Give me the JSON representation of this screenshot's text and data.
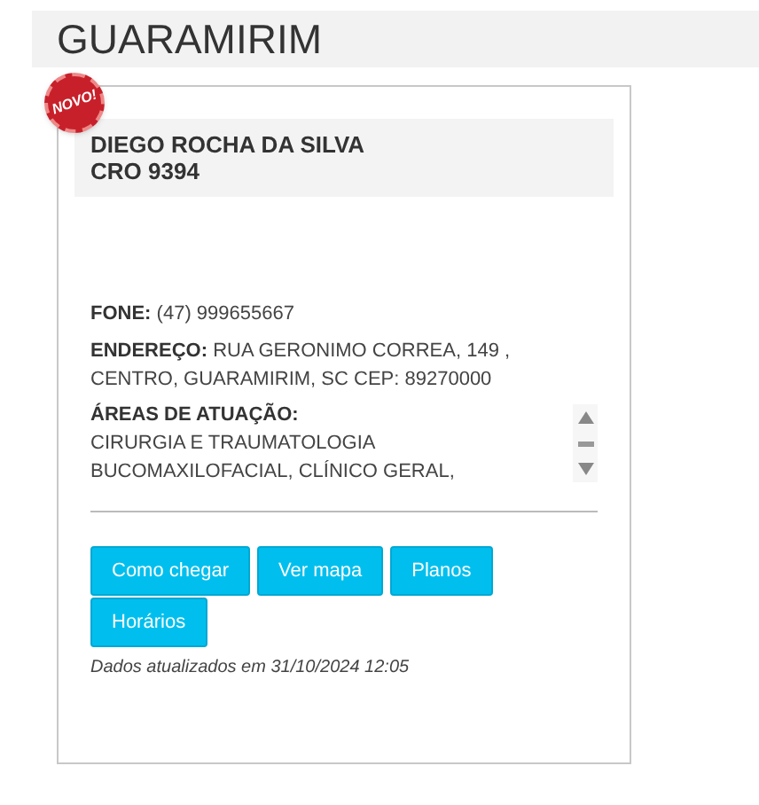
{
  "heading": "GUARAMIRIM",
  "card": {
    "badge": "NOVO!",
    "name": "DIEGO ROCHA DA SILVA",
    "registration": "CRO 9394",
    "phone": {
      "label": "FONE:",
      "value": "(47) 999655667"
    },
    "address": {
      "label": "ENDEREÇO:",
      "value": "RUA GERONIMO CORREA, 149 , CENTRO, GUARAMIRIM, SC CEP: 89270000"
    },
    "areas": {
      "label": "ÁREAS DE ATUAÇÃO:",
      "lines": [
        "CIRURGIA E TRAUMATOLOGIA",
        "BUCOMAXILOFACIAL, CLÍNICO GERAL,"
      ]
    },
    "buttons": [
      "Como chegar",
      "Ver mapa",
      "Planos",
      "Horários"
    ],
    "updated": "Dados atualizados em 31/10/2024 12:05"
  }
}
